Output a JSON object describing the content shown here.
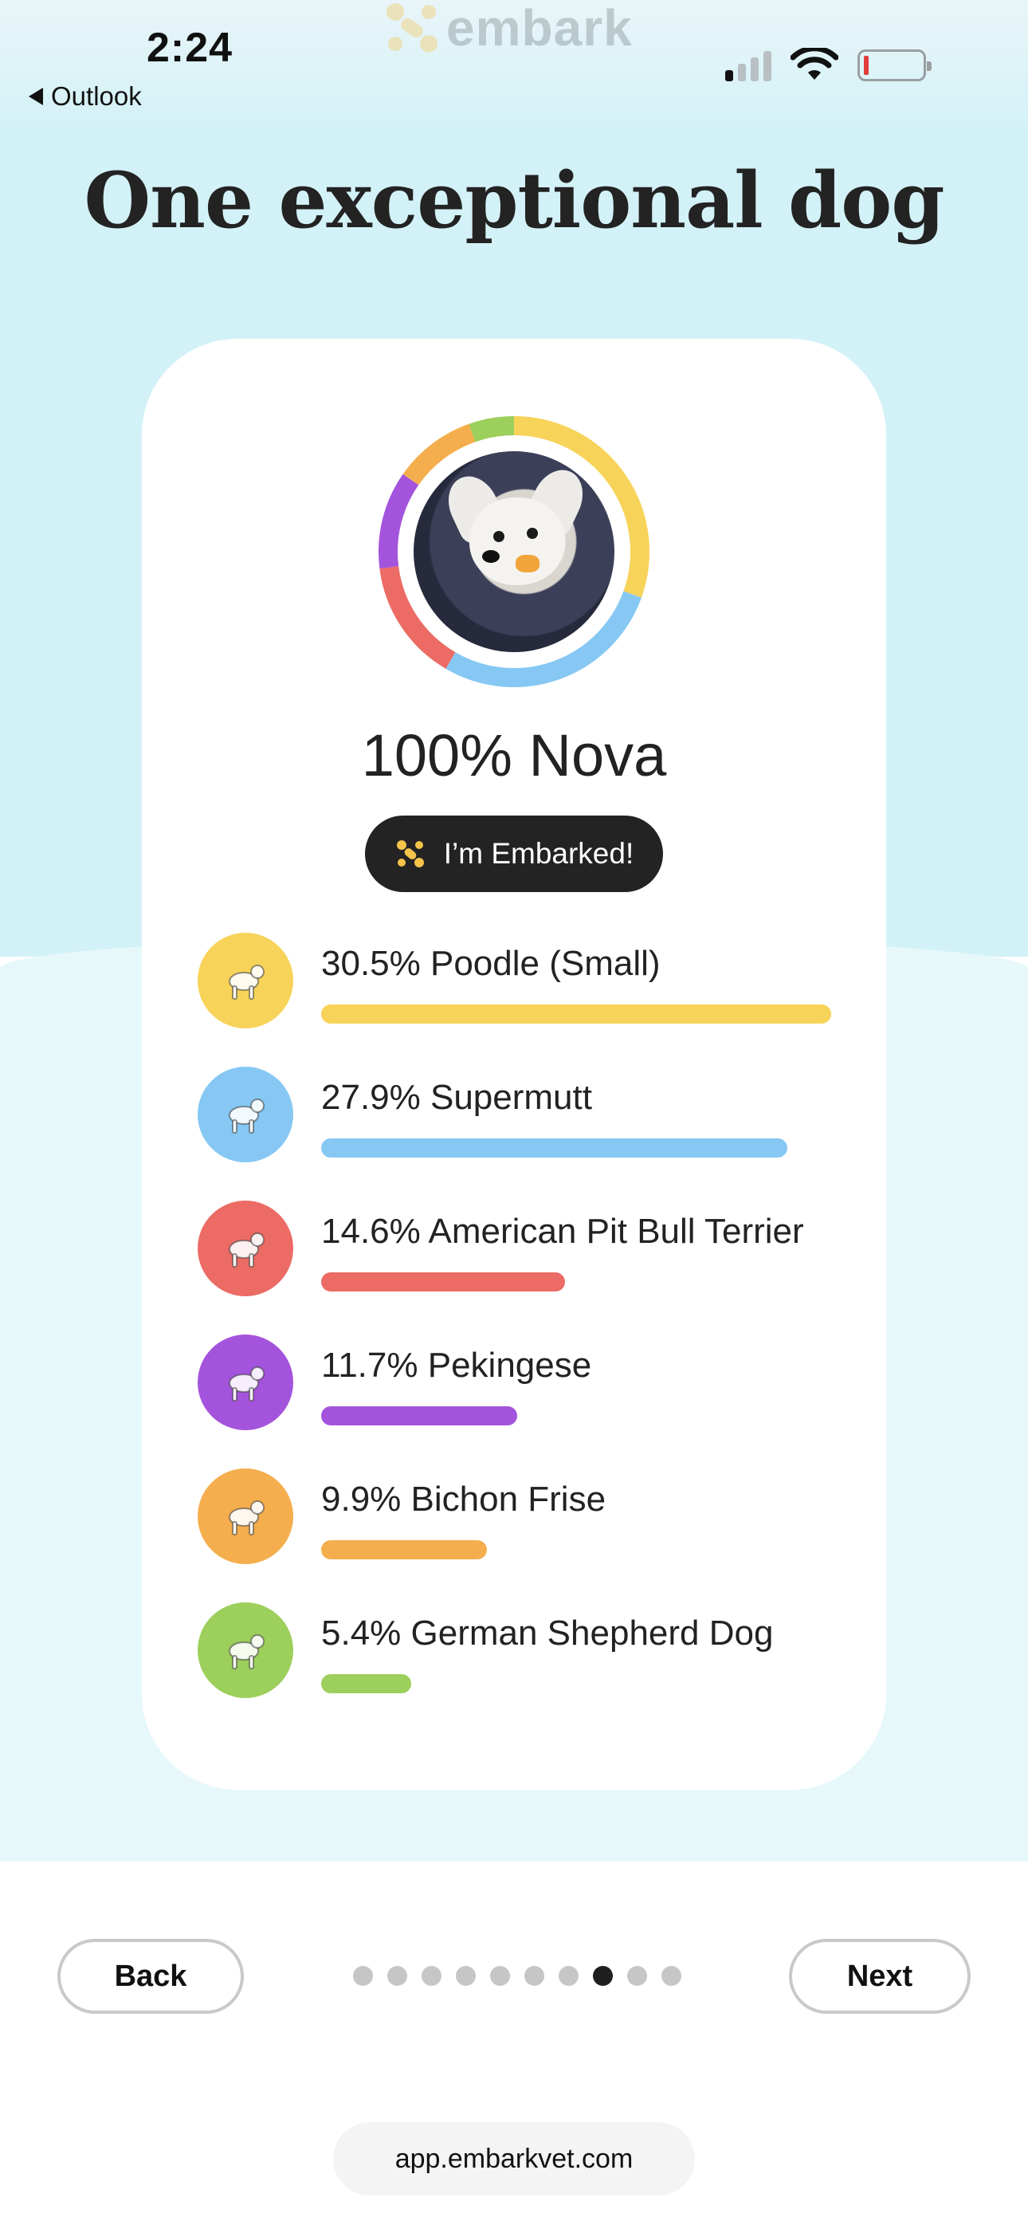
{
  "status_bar": {
    "time": "2:24",
    "back_app": "Outlook",
    "logo_text": "embark"
  },
  "title": "One exceptional dog",
  "profile": {
    "name": "100% Nova",
    "badge": "I’m Embarked!"
  },
  "breeds": [
    {
      "label": "30.5% Poodle (Small)",
      "percent": 30.5,
      "color": "#f8d35a",
      "icon": "poodle-icon"
    },
    {
      "label": "27.9% Supermutt",
      "percent": 27.9,
      "color": "#86c8f3",
      "icon": "supermutt-shield-icon"
    },
    {
      "label": "14.6% American Pit Bull Terrier",
      "percent": 14.6,
      "color": "#ec6b65",
      "icon": "pit-bull-icon"
    },
    {
      "label": "11.7% Pekingese",
      "percent": 11.7,
      "color": "#a454dc",
      "icon": "pekingese-icon"
    },
    {
      "label": "9.9% Bichon Frise",
      "percent": 9.9,
      "color": "#f5ae4d",
      "icon": "bichon-frise-icon"
    },
    {
      "label": "5.4% German Shepherd Dog",
      "percent": 5.4,
      "color": "#9ccf5b",
      "icon": "german-shepherd-icon"
    }
  ],
  "nav": {
    "back": "Back",
    "next": "Next",
    "total_pages": 10,
    "current_page": 8
  },
  "url": "app.embarkvet.com"
}
